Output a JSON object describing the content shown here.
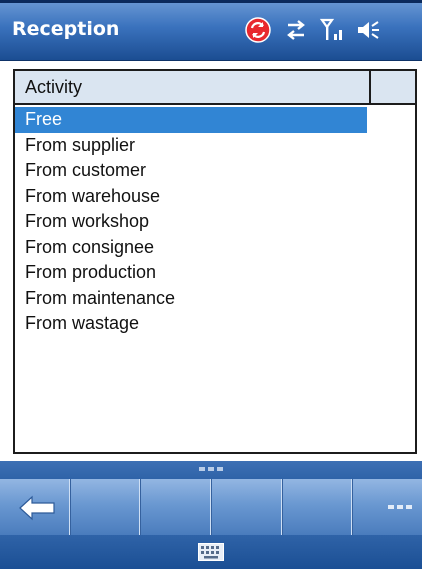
{
  "window": {
    "title": "Reception"
  },
  "status_icons": [
    "sync-error-icon",
    "data-transfer-icon",
    "signal-strength-icon",
    "speaker-muted-icon"
  ],
  "list": {
    "column_header": "Activity",
    "items": [
      {
        "label": "Free",
        "selected": true
      },
      {
        "label": "From supplier",
        "selected": false
      },
      {
        "label": "From customer",
        "selected": false
      },
      {
        "label": "From warehouse",
        "selected": false
      },
      {
        "label": "From workshop",
        "selected": false
      },
      {
        "label": "From consignee",
        "selected": false
      },
      {
        "label": "From production",
        "selected": false
      },
      {
        "label": "From maintenance",
        "selected": false
      },
      {
        "label": "From wastage",
        "selected": false
      }
    ]
  },
  "softkeys": [
    "back-arrow-icon",
    "",
    "",
    "",
    "",
    "more-icon"
  ],
  "input_panel": {
    "icon": "keyboard-icon"
  },
  "colors": {
    "selection": "#3185d4",
    "titlebar": "#3a72bd",
    "header_fill": "#dae5f1"
  }
}
